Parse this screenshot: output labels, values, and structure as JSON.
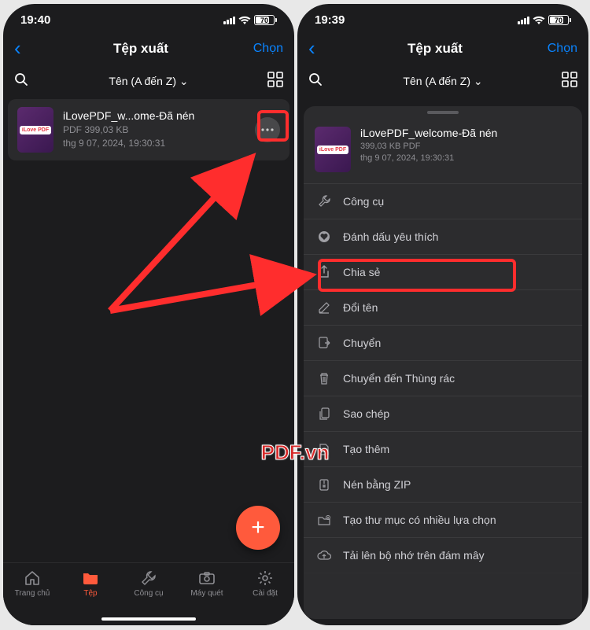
{
  "left": {
    "status": {
      "time": "19:40",
      "battery": "70"
    },
    "nav": {
      "title": "Tệp xuất",
      "right": "Chọn"
    },
    "sort": "Tên (A đến Z) ⌄",
    "file": {
      "name": "iLovePDF_w...ome-Đã nén",
      "meta1": "PDF 399,03 KB",
      "meta2": "thg 9 07, 2024, 19:30:31"
    },
    "tabs": {
      "home": "Trang chủ",
      "files": "Tệp",
      "tools": "Công cụ",
      "scanner": "Máy quét",
      "settings": "Cài đặt"
    }
  },
  "right": {
    "status": {
      "time": "19:39",
      "battery": "70"
    },
    "nav": {
      "title": "Tệp xuất",
      "right": "Chọn"
    },
    "sort": "Tên (A đến Z) ⌄",
    "sheet_file": {
      "name": "iLovePDF_welcome-Đã nén",
      "meta1": "399,03 KB PDF",
      "meta2": "thg 9 07, 2024, 19:30:31"
    },
    "menu": {
      "tools": "Công cụ",
      "favorite": "Đánh dấu yêu thích",
      "share": "Chia sẻ",
      "rename": "Đổi tên",
      "move": "Chuyển",
      "trash": "Chuyển đến Thùng rác",
      "copy": "Sao chép",
      "create_more": "Tạo thêm",
      "zip": "Nén bằng ZIP",
      "newfolder": "Tạo thư mục có nhiều lựa chọn",
      "upload": "Tải lên bộ nhớ trên đám mây"
    }
  },
  "thumb_badge": "iLove PDF",
  "watermark": "PDF.vn"
}
